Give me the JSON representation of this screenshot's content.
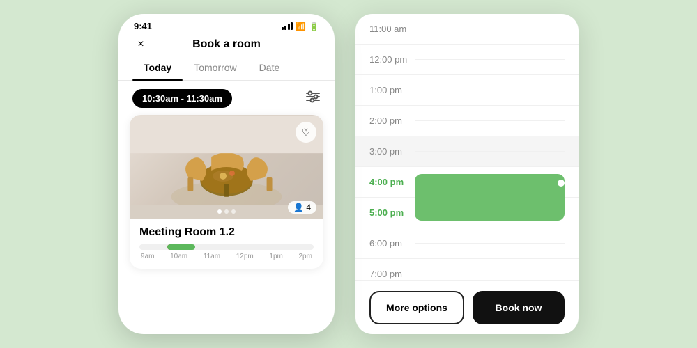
{
  "app": {
    "background_color": "#d4e8d0"
  },
  "phone": {
    "status_bar": {
      "time": "9:41"
    },
    "header": {
      "title": "Book a room",
      "close_label": "×"
    },
    "tabs": [
      {
        "label": "Today",
        "active": true
      },
      {
        "label": "Tomorrow",
        "active": false
      },
      {
        "label": "Date",
        "active": false
      }
    ],
    "time_filter": {
      "time_range": "10:30am - 11:30am",
      "filter_icon": "⊞"
    },
    "room_card": {
      "name": "Meeting Room 1.2",
      "capacity": "4",
      "timeline_labels": [
        "9am",
        "10am",
        "11am",
        "12pm",
        "1pm",
        "2pm"
      ]
    }
  },
  "right_panel": {
    "time_slots": [
      {
        "label": "11:00 am",
        "green": false,
        "gray": false
      },
      {
        "label": "12:00 pm",
        "green": false,
        "gray": false
      },
      {
        "label": "1:00 pm",
        "green": false,
        "gray": false
      },
      {
        "label": "2:00 pm",
        "green": false,
        "gray": false
      },
      {
        "label": "3:00 pm",
        "green": false,
        "gray": true
      },
      {
        "label": "4:00 pm",
        "green": true,
        "gray": false,
        "block_start": true
      },
      {
        "label": "5:00 pm",
        "green": true,
        "gray": false,
        "block_end": true
      },
      {
        "label": "6:00 pm",
        "green": false,
        "gray": false
      },
      {
        "label": "7:00 pm",
        "green": false,
        "gray": false
      }
    ],
    "buttons": {
      "more_options": "More options",
      "book_now": "Book now"
    }
  }
}
